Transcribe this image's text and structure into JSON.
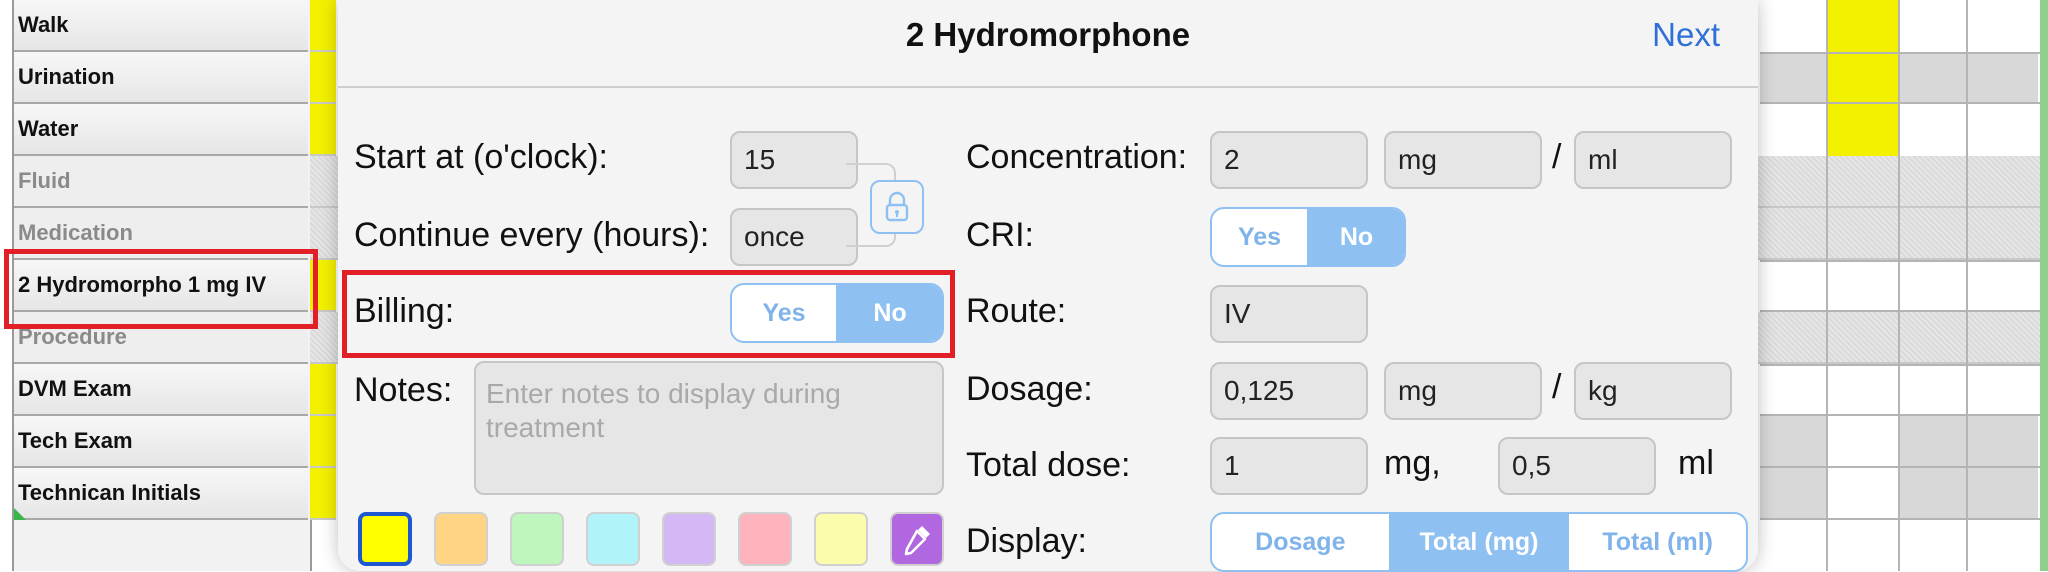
{
  "sheet": {
    "rows": [
      {
        "label": "Walk",
        "style": "normal"
      },
      {
        "label": "Urination",
        "style": "normal"
      },
      {
        "label": "Water",
        "style": "normal"
      },
      {
        "label": "Fluid",
        "style": "grey"
      },
      {
        "label": "Medication",
        "style": "grey"
      },
      {
        "label": "2 Hydromorpho 1 mg IV",
        "style": "normal"
      },
      {
        "label": "Procedure",
        "style": "grey"
      },
      {
        "label": "DVM Exam",
        "style": "normal"
      },
      {
        "label": "Tech Exam",
        "style": "normal"
      },
      {
        "label": "Technican Initials",
        "style": "normal"
      }
    ]
  },
  "modal": {
    "title": "2 Hydromorphone",
    "next_label": "Next",
    "start_label": "Start at (o'clock):",
    "start_value": "15",
    "continue_label": "Continue every (hours):",
    "continue_value": "once",
    "billing_label": "Billing:",
    "billing_yes": "Yes",
    "billing_no": "No",
    "billing_selected": "No",
    "notes_label": "Notes:",
    "notes_placeholder": "Enter notes to display during treatment",
    "concentration_label": "Concentration:",
    "concentration_value": "2",
    "concentration_unit": "mg",
    "concentration_sep": "/",
    "concentration_per": "ml",
    "cri_label": "CRI:",
    "cri_yes": "Yes",
    "cri_no": "No",
    "cri_selected": "No",
    "route_label": "Route:",
    "route_value": "IV",
    "dosage_label": "Dosage:",
    "dosage_value": "0,125",
    "dosage_unit": "mg",
    "dosage_sep": "/",
    "dosage_per": "kg",
    "total_label": "Total dose:",
    "total_mg_value": "1",
    "total_mg_unit": "mg,",
    "total_ml_value": "0,5",
    "total_ml_unit": "ml",
    "display_label": "Display:",
    "display_options": [
      "Dosage",
      "Total (mg)",
      "Total (ml)"
    ],
    "display_selected": "Total (mg)",
    "colors": [
      "#ffff00",
      "#ffd484",
      "#bdf7bd",
      "#b0f3f8",
      "#d4b8f5",
      "#ffb3bd",
      "#fcfcad",
      "#b067e0"
    ],
    "selected_color": "#ffff00",
    "picker_icon": "eyedropper-icon",
    "lock_icon": "lock-icon"
  },
  "colors": {
    "accent": "#2f6fd8",
    "segment_on": "#8ec0f2",
    "highlight_red": "#e21f26",
    "row_yellow": "#f3f000"
  }
}
